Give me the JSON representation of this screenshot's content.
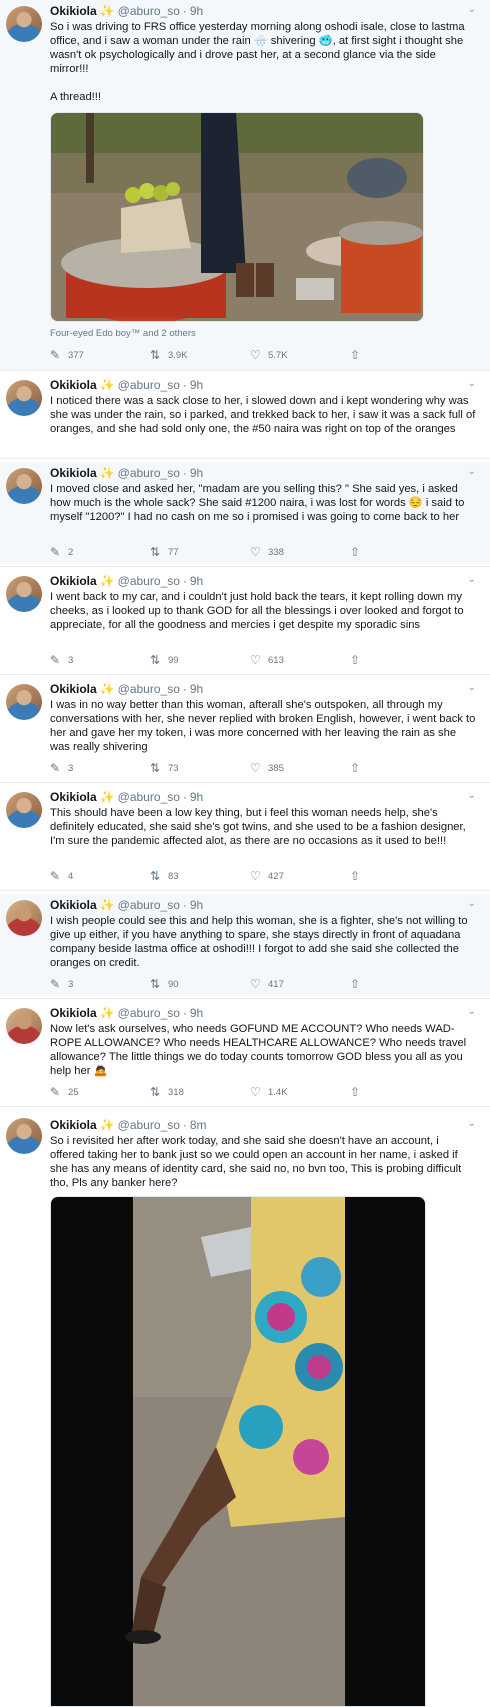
{
  "tweets": [
    {
      "name": "Okikiola",
      "spark": "✨",
      "handle": "@aburo_so",
      "dot": "·",
      "time": "9h",
      "text": "So i was driving to FRS office yesterday morning along oshodi isale, close to lastma office, and i saw a woman under the rain 🌧️ shivering 🥶, at first sight i thought she wasn't ok psychologically and i drove past her, at a second glance via the side mirror!!!\n\nA thread!!!",
      "caption": "Four-eyed Edo boy™ and 2 others",
      "replies": "377",
      "retweets": "3.9K",
      "likes": "5.7K"
    },
    {
      "name": "Okikiola",
      "spark": "✨",
      "handle": "@aburo_so",
      "dot": "·",
      "time": "9h",
      "text": "I noticed there was a sack close to her, i slowed down and i kept wondering why was she was under the rain, so i parked, and trekked back to her, i saw it was a sack full of oranges, and she had sold only one, the #50 naira was right on top of the oranges"
    },
    {
      "name": "Okikiola",
      "spark": "✨",
      "handle": "@aburo_so",
      "dot": "·",
      "time": "9h",
      "text": "I moved close and asked her, \"madam are you selling this? \" She said yes, i asked how much is the whole sack? She said #1200 naira, i was lost for words 😔 i said to myself \"1200?\" I had no cash on me so i promised i was going to come back to her",
      "replies": "2",
      "retweets": "77",
      "likes": "338"
    },
    {
      "name": "Okikiola",
      "spark": "✨",
      "handle": "@aburo_so",
      "dot": "·",
      "time": "9h",
      "text": "I went back to my car, and i couldn't just hold back the tears, it kept rolling down my cheeks, as i looked up to thank GOD for all the blessings i over looked and forgot to appreciate, for all the goodness and mercies i get despite my sporadic sins",
      "replies": "3",
      "retweets": "99",
      "likes": "613"
    },
    {
      "name": "Okikiola",
      "spark": "✨",
      "handle": "@aburo_so",
      "dot": "·",
      "time": "9h",
      "text": "I was in no way better than this woman, afterall she's outspoken, all through my conversations with her, she never replied with broken English, however, i went back to her and gave her my token, i was more concerned with her leaving the rain as she was really shivering",
      "replies": "3",
      "retweets": "73",
      "likes": "385"
    },
    {
      "name": "Okikiola",
      "spark": "✨",
      "handle": "@aburo_so",
      "dot": "·",
      "time": "9h",
      "text": "This should have been a low key thing, but i feel this woman needs help, she's definitely educated, she said she's got twins, and she used to be a fashion designer, I'm sure the pandemic affected alot, as there are no occasions as it used to be!!!",
      "replies": "4",
      "retweets": "83",
      "likes": "427"
    },
    {
      "name": "Okikiola",
      "spark": "✨",
      "handle": "@aburo_so",
      "dot": "·",
      "time": "9h",
      "text": "I wish people could see this and help this woman, she is a fighter, she's not willing to give up either, if you have anything to spare, she stays directly in front of aquadana company beside lastma office at oshodi!!! I forgot to add she said she collected the oranges on credit.",
      "replies": "3",
      "retweets": "90",
      "likes": "417"
    },
    {
      "name": "Okikiola",
      "spark": "✨",
      "handle": "@aburo_so",
      "dot": "·",
      "time": "9h",
      "text": "Now let's ask ourselves, who needs GOFUND ME ACCOUNT? Who needs WAD-ROPE ALLOWANCE? Who needs HEALTHCARE ALLOWANCE? Who needs travel allowance? The little things we do today counts tomorrow GOD bless you all as you help her 🙇",
      "replies": "25",
      "retweets": "318",
      "likes": "1.4K"
    },
    {
      "name": "Okikiola",
      "spark": "✨",
      "handle": "@aburo_so",
      "dot": "·",
      "time": "8m",
      "text": "So i revisited her after work today, and she said she doesn't have an account, i offered taking her to bank just so we could open an account in her name, i asked if she has any means of identity card, she said no, no bvn too, This is probing difficult tho, Pls any banker here?"
    }
  ],
  "icons": {
    "reply": "reply-icon",
    "retweet": "retweet-icon",
    "like": "like-icon",
    "share": "share-icon",
    "caret": "chevron-down-icon"
  },
  "colors": {
    "accent_star": "#f5b400",
    "muted": "#657786",
    "shaded_bg": "#f5f8fa"
  }
}
